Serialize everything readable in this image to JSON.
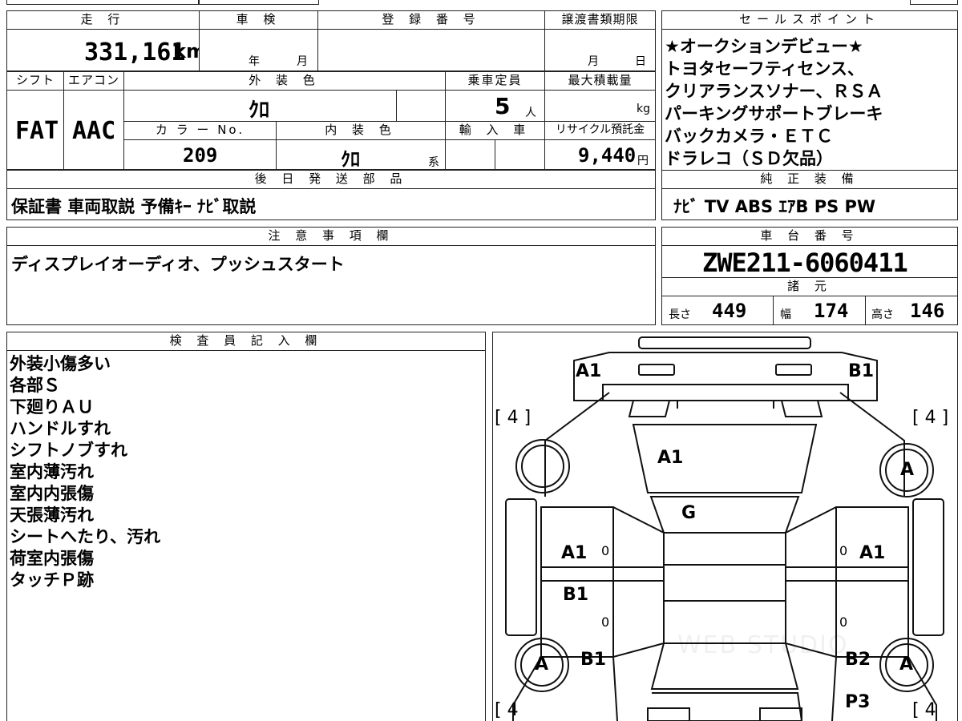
{
  "headers": {
    "mileage": "走 行",
    "inspection": "車 検",
    "registration": "登 録 番 号",
    "transfer_deadline": "譲渡書類期限",
    "sales_point": "セールスポイント",
    "shift": "シフト",
    "aircon": "エアコン",
    "exterior_color": "外 装 色",
    "capacity": "乗車定員",
    "max_load": "最大積載量",
    "color_no": "カ ラ ー No.",
    "interior_color": "内 装 色",
    "import": "輸 入 車",
    "recycle": "リサイクル預託金",
    "later_parts": "後 日 発 送 部 品",
    "genuine_equipment": "純 正 装 備",
    "notes": "注 意 事 項 欄",
    "chassis_no": "車 台 番 号",
    "specs": "諸 元",
    "inspector": "検 査 員 記 入 欄"
  },
  "vehicle": {
    "mileage": "331,161",
    "mileage_unit": "km",
    "inspection_year_unit": "年",
    "inspection_month_unit": "月",
    "transfer_month_unit": "月",
    "transfer_day_unit": "日",
    "shift": "FAT",
    "aircon": "AAC",
    "exterior_color": "ｸﾛ",
    "capacity": "5",
    "capacity_unit": "人",
    "max_load_unit": "kg",
    "color_no": "209",
    "interior_color": "ｸﾛ",
    "interior_suffix": "系",
    "recycle_fee": "9,440",
    "recycle_unit": "円",
    "later_parts": "保証書 車両取説 予備ｷｰ ﾅﾋﾞ取説",
    "genuine_equipment": "ﾅﾋﾞ TV ABS ｴｱB PS PW",
    "notes": "ディスプレイオーディオ、プッシュスタート",
    "chassis_no": "ZWE211-6060411",
    "length_label": "長さ",
    "length": "449",
    "width_label": "幅",
    "width": "174",
    "height_label": "高さ",
    "height": "146"
  },
  "sales_points": [
    "★オークションデビュー★",
    "トヨタセーフティセンス、",
    "クリアランスソナー、ＲＳＡ",
    "パーキングサポートブレーキ",
    "バックカメラ・ＥＴＣ",
    "ドラレコ（ＳＤ欠品）"
  ],
  "inspector_notes": [
    "外装小傷多い",
    "各部Ｓ",
    "下廻りＡＵ",
    "ハンドルすれ",
    "シフトノブすれ",
    "室内薄汚れ",
    "室内内張傷",
    "天張薄汚れ",
    "シートへたり、汚れ",
    "荷室内張傷",
    "タッチＰ跡"
  ],
  "diagram": {
    "front_left": "A1",
    "front_right": "B1",
    "hood": "A1",
    "windshield": "G",
    "front_left_door": "A1",
    "front_right_door": "A1",
    "rear_left_door": "B1",
    "rear_left_fender": "B1",
    "rear_right_quarter": "B2",
    "rear_right": "P3",
    "wheel_front_right": "A",
    "wheel_rear_left": "A",
    "wheel_rear_right": "A",
    "tire_fl": "[ 4 ]",
    "tire_fr": "[ 4 ]",
    "tire_rl": "[ 4",
    "tire_rr": "[ 4",
    "zero_1": "0",
    "zero_2": "0",
    "zero_3": "0",
    "zero_4": "0",
    "watermark": "WEB STUDIO"
  }
}
